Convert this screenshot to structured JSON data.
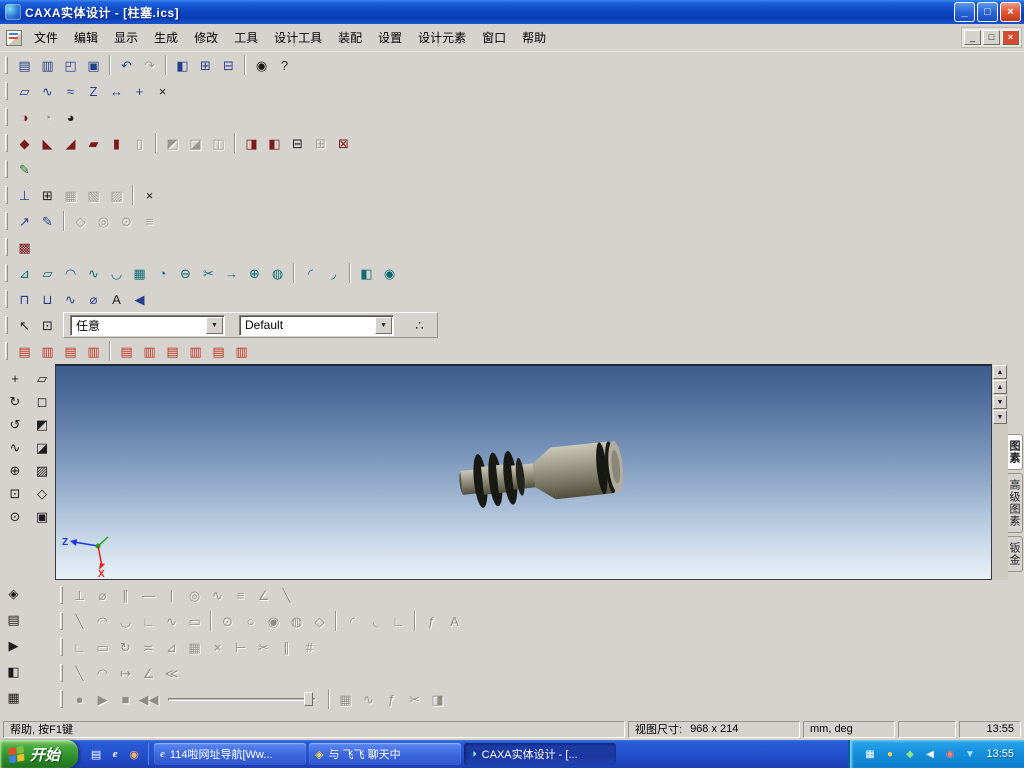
{
  "window": {
    "title": "CAXA实体设计 - [柱塞.ics]",
    "minimize_glyph": "_",
    "maximize_glyph": "□",
    "close_glyph": "×"
  },
  "mdi": {
    "minimize_glyph": "_",
    "restore_glyph": "□",
    "close_glyph": "×"
  },
  "menu": {
    "items": [
      {
        "label": "文件"
      },
      {
        "label": "编辑"
      },
      {
        "label": "显示"
      },
      {
        "label": "生成"
      },
      {
        "label": "修改"
      },
      {
        "label": "工具"
      },
      {
        "label": "设计工具"
      },
      {
        "label": "装配"
      },
      {
        "label": "设置"
      },
      {
        "label": "设计元素"
      },
      {
        "label": "窗口"
      },
      {
        "label": "帮助"
      }
    ]
  },
  "toolbars": {
    "standard": [
      {
        "name": "new-design",
        "glyph": "▤",
        "variant": "blue"
      },
      {
        "name": "new-drawing",
        "glyph": "▥",
        "variant": "blue"
      },
      {
        "name": "open-file",
        "glyph": "◰",
        "variant": "blue"
      },
      {
        "name": "save-file",
        "glyph": "▣",
        "variant": "blue"
      },
      {
        "name": "separator",
        "glyph": "",
        "variant": "sep"
      },
      {
        "name": "undo",
        "glyph": "↶",
        "variant": "blue"
      },
      {
        "name": "redo",
        "glyph": "↷",
        "variant": "gray"
      },
      {
        "name": "separator",
        "glyph": "",
        "variant": "sep"
      },
      {
        "name": "output-image",
        "glyph": "◧",
        "variant": "blue"
      },
      {
        "name": "copy-view",
        "glyph": "⊞",
        "variant": "blue"
      },
      {
        "name": "print",
        "glyph": "⊟",
        "variant": "blue"
      },
      {
        "name": "separator",
        "glyph": "",
        "variant": "sep"
      },
      {
        "name": "search",
        "glyph": "◉",
        "variant": "dark"
      },
      {
        "name": "context-help",
        "glyph": "?",
        "variant": "dark"
      }
    ],
    "design": [
      {
        "name": "insert-sketch",
        "glyph": "▱",
        "variant": "blue"
      },
      {
        "name": "insert-3d-curve",
        "glyph": "∿",
        "variant": "blue"
      },
      {
        "name": "insert-spline",
        "glyph": "≈",
        "variant": "blue"
      },
      {
        "name": "insert-z-plane",
        "glyph": "Z",
        "variant": "blue"
      },
      {
        "name": "insert-dimension",
        "glyph": "↔",
        "variant": "blue"
      },
      {
        "name": "insert-axis",
        "glyph": "+",
        "variant": "blue"
      },
      {
        "name": "delete-element",
        "glyph": "×",
        "variant": "dark"
      }
    ],
    "render": [
      {
        "name": "smart-render",
        "glyph": "◑",
        "variant": "maroon"
      },
      {
        "name": "smart-animation",
        "glyph": "◔",
        "variant": "gray"
      },
      {
        "name": "smart-motion",
        "glyph": "◕",
        "variant": "dark"
      }
    ],
    "advanced_render": [
      {
        "name": "paint-part",
        "glyph": "◆",
        "variant": "maroon"
      },
      {
        "name": "paint-surface",
        "glyph": "◣",
        "variant": "maroon"
      },
      {
        "name": "paint-edge",
        "glyph": "◢",
        "variant": "maroon"
      },
      {
        "name": "apply-texture",
        "glyph": "▰",
        "variant": "maroon"
      },
      {
        "name": "apply-bump",
        "glyph": "▮",
        "variant": "maroon"
      },
      {
        "name": "apply-decal",
        "glyph": "▯",
        "variant": "gray"
      },
      {
        "name": "separator",
        "glyph": "",
        "variant": "sep"
      },
      {
        "name": "texture-wizard",
        "glyph": "◩",
        "variant": "gray"
      },
      {
        "name": "bump-wizard",
        "glyph": "◪",
        "variant": "gray"
      },
      {
        "name": "decal-wizard",
        "glyph": "◫",
        "variant": "gray"
      },
      {
        "name": "separator",
        "glyph": "",
        "variant": "sep"
      },
      {
        "name": "set-background",
        "glyph": "◨",
        "variant": "maroon"
      },
      {
        "name": "set-foreground",
        "glyph": "◧",
        "variant": "maroon"
      },
      {
        "name": "set-shadow",
        "glyph": "⊟",
        "variant": "dark"
      },
      {
        "name": "set-reflection",
        "glyph": "⊞",
        "variant": "gray"
      },
      {
        "name": "render-options",
        "glyph": "⊠",
        "variant": "maroon"
      }
    ],
    "sketch": [
      {
        "name": "draw-curve",
        "glyph": "✎",
        "variant": "green"
      }
    ],
    "feature": [
      {
        "name": "custom-hole",
        "glyph": "⊥",
        "variant": "blue"
      },
      {
        "name": "standard-hole",
        "glyph": "⊞",
        "variant": "dark"
      },
      {
        "name": "cavity-feature",
        "glyph": "▦",
        "variant": "gray"
      },
      {
        "name": "boss-feature",
        "glyph": "▧",
        "variant": "gray"
      },
      {
        "name": "rib-feature",
        "glyph": "▨",
        "variant": "gray"
      },
      {
        "name": "separator",
        "glyph": "",
        "variant": "sep"
      },
      {
        "name": "remove-feature",
        "glyph": "×",
        "variant": "dark"
      }
    ],
    "tools": [
      {
        "name": "measure-distance",
        "glyph": "↗",
        "variant": "blue"
      },
      {
        "name": "annotate",
        "glyph": "✎",
        "variant": "blue"
      },
      {
        "name": "separator",
        "glyph": "",
        "variant": "sep"
      },
      {
        "name": "check-interference",
        "glyph": "◇",
        "variant": "gray"
      },
      {
        "name": "check-surface",
        "glyph": "◎",
        "variant": "gray"
      },
      {
        "name": "check-draft",
        "glyph": "⊙",
        "variant": "gray"
      },
      {
        "name": "mass-properties",
        "glyph": "≡",
        "variant": "gray"
      }
    ],
    "palette": [
      {
        "name": "color-palette",
        "glyph": "▩",
        "variant": "maroon"
      }
    ],
    "surface": [
      {
        "name": "ruled-surface",
        "glyph": "⊿",
        "variant": "teal"
      },
      {
        "name": "extrude-surface",
        "glyph": "▱",
        "variant": "teal"
      },
      {
        "name": "revolve-surface",
        "glyph": "◠",
        "variant": "teal"
      },
      {
        "name": "sweep-surface",
        "glyph": "∿",
        "variant": "teal"
      },
      {
        "name": "loft-surface",
        "glyph": "◡",
        "variant": "teal"
      },
      {
        "name": "mesh-surface",
        "glyph": "▦",
        "variant": "teal"
      },
      {
        "name": "patch-surface",
        "glyph": "◔",
        "variant": "teal"
      },
      {
        "name": "offset-surface",
        "glyph": "⊖",
        "variant": "teal"
      },
      {
        "name": "trim-surface",
        "glyph": "✂",
        "variant": "teal"
      },
      {
        "name": "extend-surface",
        "glyph": "→",
        "variant": "teal"
      },
      {
        "name": "stitch-surface",
        "glyph": "⊕",
        "variant": "teal"
      },
      {
        "name": "fill-surface",
        "glyph": "◍",
        "variant": "teal"
      },
      {
        "name": "separator",
        "glyph": "",
        "variant": "sep"
      },
      {
        "name": "surface-fillet",
        "glyph": "◜",
        "variant": "teal"
      },
      {
        "name": "surface-trim-solid",
        "glyph": "◞",
        "variant": "teal"
      },
      {
        "name": "separator",
        "glyph": "",
        "variant": "sep"
      },
      {
        "name": "thicken-surface",
        "glyph": "◧",
        "variant": "teal"
      },
      {
        "name": "surface-analysis",
        "glyph": "◉",
        "variant": "teal"
      }
    ],
    "text3d": [
      {
        "name": "emboss-text",
        "glyph": "⊓",
        "variant": "blue"
      },
      {
        "name": "engrave-text",
        "glyph": "⊔",
        "variant": "blue"
      },
      {
        "name": "helix-curve",
        "glyph": "∿",
        "variant": "blue"
      },
      {
        "name": "projection-curve",
        "glyph": "⌀",
        "variant": "blue"
      },
      {
        "name": "text-wizard",
        "glyph": "A",
        "variant": "dark"
      },
      {
        "name": "sound-effect",
        "glyph": "◀",
        "variant": "blue"
      }
    ],
    "select_icons": [
      {
        "name": "select-arrow",
        "glyph": "↖",
        "variant": "dark"
      },
      {
        "name": "select-box",
        "glyph": "⊡",
        "variant": "dark"
      }
    ],
    "selection": {
      "filter_value": "任意",
      "style_value": "Default",
      "tree_button_glyph": "∴"
    },
    "view_configs": [
      {
        "name": "view-config-1",
        "glyph": "▤",
        "variant": "red"
      },
      {
        "name": "view-config-2",
        "glyph": "▥",
        "variant": "red"
      },
      {
        "name": "view-config-3",
        "glyph": "▤",
        "variant": "red"
      },
      {
        "name": "view-config-4",
        "glyph": "▥",
        "variant": "red"
      },
      {
        "name": "separator",
        "glyph": "",
        "variant": "sep"
      },
      {
        "name": "view-config-5",
        "glyph": "▤",
        "variant": "red"
      },
      {
        "name": "view-config-6",
        "glyph": "▥",
        "variant": "red"
      },
      {
        "name": "view-config-7",
        "glyph": "▤",
        "variant": "red"
      },
      {
        "name": "view-config-8",
        "glyph": "▥",
        "variant": "red"
      },
      {
        "name": "view-config-9",
        "glyph": "▤",
        "variant": "red"
      },
      {
        "name": "view-config-10",
        "glyph": "▥",
        "variant": "red"
      }
    ]
  },
  "left_toolbar": {
    "top": [
      {
        "name": "pan-view",
        "glyph": "+",
        "variant": "dark"
      },
      {
        "name": "sketch-view",
        "glyph": "▱",
        "variant": "dark"
      },
      {
        "name": "rotate-view",
        "glyph": "↻",
        "variant": "dark"
      },
      {
        "name": "front-view",
        "glyph": "◻",
        "variant": "dark"
      },
      {
        "name": "spin-view",
        "glyph": "↺",
        "variant": "dark"
      },
      {
        "name": "iso-view",
        "glyph": "◩",
        "variant": "dark"
      },
      {
        "name": "curve-view",
        "glyph": "∿",
        "variant": "dark"
      },
      {
        "name": "shaded-display",
        "glyph": "◪",
        "variant": "dark"
      },
      {
        "name": "zoom-in-out",
        "glyph": "⊕",
        "variant": "dark"
      },
      {
        "name": "wireframe-display",
        "glyph": "▨",
        "variant": "dark"
      },
      {
        "name": "zoom-window",
        "glyph": "⊡",
        "variant": "dark"
      },
      {
        "name": "perspective-display",
        "glyph": "◇",
        "variant": "dark"
      },
      {
        "name": "zoom-all",
        "glyph": "⊙",
        "variant": "dark"
      },
      {
        "name": "display-options",
        "glyph": "▣",
        "variant": "dark"
      }
    ],
    "bottom": [
      {
        "name": "design-environment",
        "glyph": "◈",
        "variant": "dark"
      },
      {
        "name": "scene-browser",
        "glyph": "▤",
        "variant": "dark"
      },
      {
        "name": "animation-browser",
        "glyph": "▶",
        "variant": "dark"
      },
      {
        "name": "render-browser",
        "glyph": "◧",
        "variant": "dark"
      },
      {
        "name": "material-browser",
        "glyph": "▦",
        "variant": "dark"
      }
    ]
  },
  "viewport": {
    "part_body_color": "#9a9786",
    "part_ring_color": "#1a1a14",
    "axis_z_color": "#2233ee",
    "axis_x_color": "#e02020",
    "axis_y_color": "#18a818",
    "scroll_buttons": [
      {
        "name": "scroll-up",
        "glyph": "▲"
      },
      {
        "name": "scroll-page-up",
        "glyph": "▲"
      },
      {
        "name": "scroll-down",
        "glyph": "▼"
      },
      {
        "name": "scroll-page-down",
        "glyph": "▼"
      }
    ],
    "triad_z_label": "Z",
    "triad_x_label": "X"
  },
  "right_panel": {
    "tabs": [
      {
        "label": "图素",
        "variant": "selected"
      },
      {
        "label": "高级图素",
        "variant": ""
      },
      {
        "label": "钣金",
        "variant": ""
      }
    ]
  },
  "bottom_toolbars": {
    "constraints": [
      {
        "name": "perpendicular-constraint",
        "glyph": "⊥"
      },
      {
        "name": "diameter-dimension",
        "glyph": "⌀"
      },
      {
        "name": "parallel-constraint",
        "glyph": "∥"
      },
      {
        "name": "horizontal-constraint",
        "glyph": "―"
      },
      {
        "name": "vertical-constraint",
        "glyph": "|"
      },
      {
        "name": "concentric-constraint",
        "glyph": "◎"
      },
      {
        "name": "tangent-constraint",
        "glyph": "∿"
      },
      {
        "name": "equal-constraint",
        "glyph": "≡"
      },
      {
        "name": "angle-dimension",
        "glyph": "∠"
      },
      {
        "name": "symmetric-constraint",
        "glyph": "╲"
      }
    ],
    "draw": [
      {
        "name": "draw-line",
        "glyph": "╲"
      },
      {
        "name": "draw-arc",
        "glyph": "◠"
      },
      {
        "name": "draw-tangent-arc",
        "glyph": "◡"
      },
      {
        "name": "draw-polyline",
        "glyph": "∟"
      },
      {
        "name": "draw-spline",
        "glyph": "∿"
      },
      {
        "name": "draw-rectangle",
        "glyph": "▭"
      },
      {
        "name": "separator",
        "glyph": "",
        "variant": "sep"
      },
      {
        "name": "draw-circle-center",
        "glyph": "⊙"
      },
      {
        "name": "draw-circle-2pt",
        "glyph": "○"
      },
      {
        "name": "draw-circle-3pt",
        "glyph": "◉"
      },
      {
        "name": "draw-ellipse",
        "glyph": "◍"
      },
      {
        "name": "draw-polygon",
        "glyph": "◇"
      },
      {
        "name": "separator",
        "glyph": "",
        "variant": "sep"
      },
      {
        "name": "draw-fillet",
        "glyph": "◜"
      },
      {
        "name": "draw-chamfer",
        "glyph": "◟"
      },
      {
        "name": "draw-corner",
        "glyph": "∟"
      },
      {
        "name": "separator",
        "glyph": "",
        "variant": "sep"
      },
      {
        "name": "draw-formula",
        "glyph": "ƒ"
      },
      {
        "name": "draw-text",
        "glyph": "A"
      }
    ],
    "modify": [
      {
        "name": "trim-curve",
        "glyph": "∟"
      },
      {
        "name": "extend-curve",
        "glyph": "▭"
      },
      {
        "name": "break-curve",
        "glyph": "↻"
      },
      {
        "name": "mirror-curve",
        "glyph": "≍"
      },
      {
        "name": "scale-curve",
        "glyph": "⊿"
      },
      {
        "name": "array-curve",
        "glyph": "▦"
      },
      {
        "name": "delete-curve",
        "glyph": "×"
      },
      {
        "name": "offset-curve",
        "glyph": "⊢"
      },
      {
        "name": "cut-curve",
        "glyph": "✂"
      },
      {
        "name": "copy-parallel",
        "glyph": "∥"
      },
      {
        "name": "grid-snap",
        "glyph": "#"
      }
    ],
    "reference": [
      {
        "name": "construction-line",
        "glyph": "╲"
      },
      {
        "name": "construction-arc",
        "glyph": "◠"
      },
      {
        "name": "project-edge",
        "glyph": "↦"
      },
      {
        "name": "intersect-edge",
        "glyph": "∠"
      },
      {
        "name": "offset-edge",
        "glyph": "≪"
      }
    ],
    "transport": [
      {
        "name": "record-animation",
        "glyph": "●"
      },
      {
        "name": "play-animation",
        "glyph": "▶"
      },
      {
        "name": "stop-animation",
        "glyph": "■"
      },
      {
        "name": "rewind-animation",
        "glyph": "◀◀"
      }
    ],
    "animation_tools": [
      {
        "name": "animation-frames",
        "glyph": "▦"
      },
      {
        "name": "animation-curve",
        "glyph": "∿"
      },
      {
        "name": "animation-path",
        "glyph": "ƒ"
      },
      {
        "name": "animation-cut",
        "glyph": "✂"
      },
      {
        "name": "animation-render",
        "glyph": "◨"
      }
    ]
  },
  "statusbar": {
    "help_text": "帮助, 按F1键",
    "view_size_label": "视图尺寸:",
    "view_size_value": "968 x 214",
    "units": "mm, deg",
    "time": "13:55"
  },
  "taskbar": {
    "start_label": "开始",
    "quick_launch": [
      {
        "name": "quick-launch-show-desktop",
        "glyph": "▤",
        "variant": "c-white"
      },
      {
        "name": "quick-launch-browser",
        "glyph": "e",
        "variant": "c-white"
      },
      {
        "name": "quick-launch-player",
        "glyph": "◉",
        "variant": "c-orange"
      }
    ],
    "tasks": [
      {
        "name": "task-browser",
        "icon_glyph": "e",
        "icon_variant": "c-blue",
        "label": "114啦网址导航[Ww...",
        "variant": ""
      },
      {
        "name": "task-chat",
        "icon_glyph": "◈",
        "icon_variant": "c-yellow",
        "label": "与 飞飞 聊天中",
        "variant": ""
      },
      {
        "name": "task-caxa",
        "icon_glyph": "◑",
        "icon_variant": "c-teal",
        "label": "CAXA实体设计 - [...",
        "variant": "active"
      }
    ],
    "tray_icons": [
      {
        "name": "tray-input-method",
        "glyph": "▦",
        "variant": "c-white"
      },
      {
        "name": "tray-qq",
        "glyph": "●",
        "variant": "c-yellow"
      },
      {
        "name": "tray-messenger",
        "glyph": "◆",
        "variant": "c-green"
      },
      {
        "name": "tray-volume",
        "glyph": "◀",
        "variant": "c-white"
      },
      {
        "name": "tray-security",
        "glyph": "◉",
        "variant": "c-red"
      },
      {
        "name": "tray-network",
        "glyph": "▼",
        "variant": "c-cyan"
      }
    ],
    "time": "13:55"
  }
}
